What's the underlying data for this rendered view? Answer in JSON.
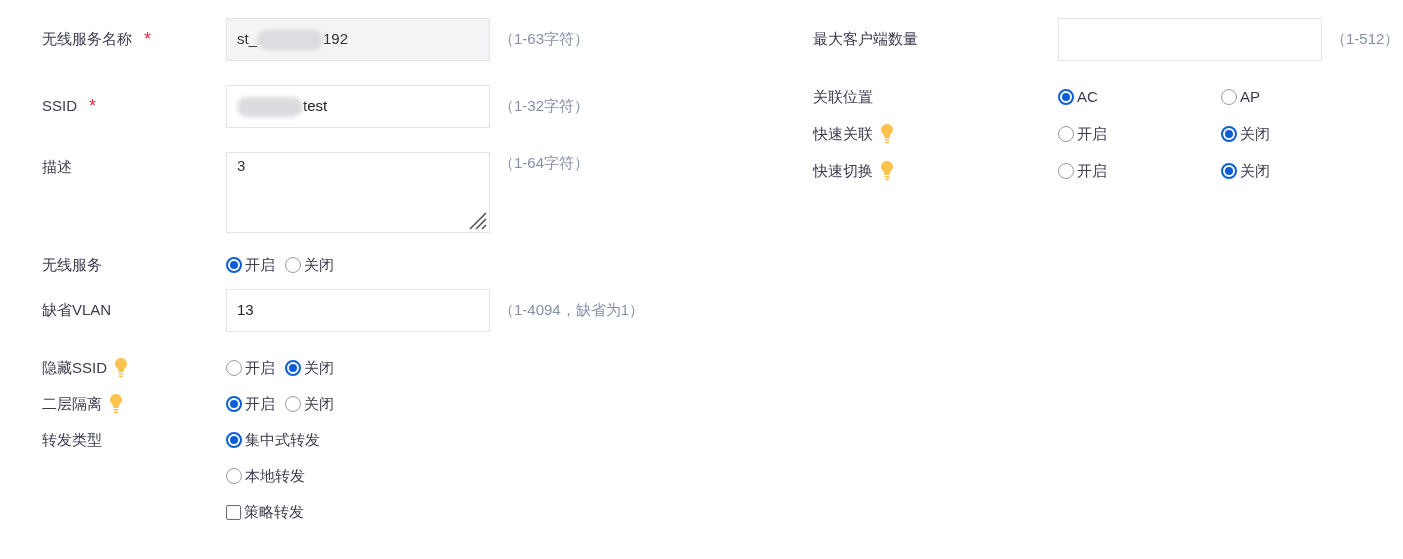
{
  "left": [
    {
      "kind": "text",
      "label": "无线服务名称",
      "required_mark": "*",
      "disabled": true,
      "value_parts": [
        {
          "kind": "text",
          "text": "st_"
        },
        {
          "kind": "blur"
        },
        {
          "kind": "text",
          "text": "192"
        }
      ],
      "hint": "（1-63字符）"
    },
    {
      "kind": "text",
      "label": "SSID",
      "required_mark": "*",
      "disabled": false,
      "value_parts": [
        {
          "kind": "blur"
        },
        {
          "kind": "text",
          "text": "test"
        }
      ],
      "hint": "（1-32字符）"
    },
    {
      "kind": "textarea",
      "label": "描述",
      "value": "3",
      "hint": "（1-64字符）"
    },
    {
      "kind": "radio",
      "label": "无线服务",
      "tip": false,
      "options": [
        {
          "label": "开启",
          "selected": true
        },
        {
          "label": "关闭",
          "selected": false
        }
      ]
    },
    {
      "kind": "text",
      "label": "缺省VLAN",
      "disabled": false,
      "value_parts": [
        {
          "kind": "text",
          "text": "13"
        }
      ],
      "hint": "（1-4094，缺省为1）"
    },
    {
      "kind": "radio",
      "label": "隐藏SSID",
      "tip": true,
      "options": [
        {
          "label": "开启",
          "selected": false
        },
        {
          "label": "关闭",
          "selected": true
        }
      ]
    },
    {
      "kind": "radio",
      "label": "二层隔离",
      "tip": true,
      "options": [
        {
          "label": "开启",
          "selected": true
        },
        {
          "label": "关闭",
          "selected": false
        }
      ]
    },
    {
      "kind": "choices",
      "label": "转发类型",
      "options": [
        {
          "kind": "radio",
          "label": "集中式转发",
          "selected": true
        },
        {
          "kind": "radio",
          "label": "本地转发",
          "selected": false
        },
        {
          "kind": "checkbox",
          "label": "策略转发",
          "checked": false
        }
      ]
    }
  ],
  "right": [
    {
      "kind": "text",
      "label": "最大客户端数量",
      "hint": "（1-512）"
    },
    {
      "kind": "radio",
      "label": "关联位置",
      "tip": false,
      "options": [
        {
          "label": "AC",
          "selected": true
        },
        {
          "label": "AP",
          "selected": false
        }
      ]
    },
    {
      "kind": "radio",
      "label": "快速关联",
      "tip": true,
      "options": [
        {
          "label": "开启",
          "selected": false
        },
        {
          "label": "关闭",
          "selected": true
        }
      ]
    },
    {
      "kind": "radio",
      "label": "快速切换",
      "tip": true,
      "options": [
        {
          "label": "开启",
          "selected": false
        },
        {
          "label": "关闭",
          "selected": true
        }
      ]
    }
  ]
}
